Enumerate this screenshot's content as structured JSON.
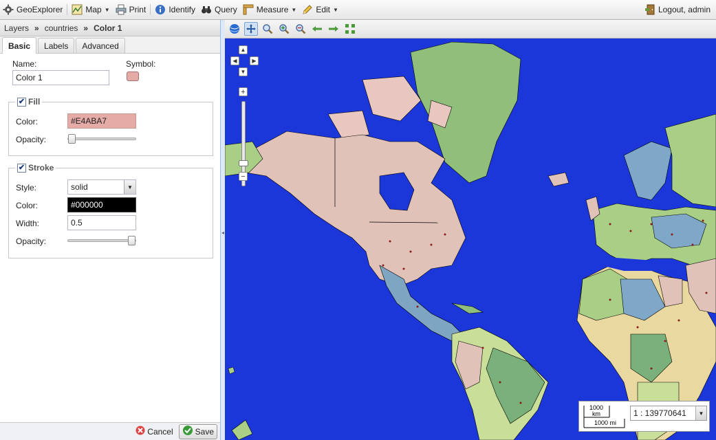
{
  "toolbar": {
    "app_name": "GeoExplorer",
    "map": "Map",
    "print": "Print",
    "identify": "Identify",
    "query": "Query",
    "measure": "Measure",
    "edit": "Edit",
    "logout": "Logout, admin"
  },
  "breadcrumb": {
    "root": "Layers",
    "sep": "»",
    "layer": "countries",
    "rule": "Color 1"
  },
  "tabs": [
    "Basic",
    "Labels",
    "Advanced"
  ],
  "form": {
    "name_label": "Name:",
    "name_value": "Color 1",
    "symbol_label": "Symbol:",
    "symbol_color": "#E4ABA7",
    "fill": {
      "legend": "Fill",
      "checked": true,
      "color_label": "Color:",
      "color_value": "#E4ABA7",
      "opacity_label": "Opacity:",
      "opacity": 0.0
    },
    "stroke": {
      "legend": "Stroke",
      "checked": true,
      "style_label": "Style:",
      "style_value": "solid",
      "color_label": "Color:",
      "color_value": "#000000",
      "width_label": "Width:",
      "width_value": "0.5",
      "opacity_label": "Opacity:",
      "opacity": 1.0
    }
  },
  "footer": {
    "cancel": "Cancel",
    "save": "Save"
  },
  "map": {
    "ocean_color": "#1B36D9",
    "scale_value": "1 : 139770641",
    "scalebar_km": "1000 km",
    "scalebar_km_top": "1000",
    "scalebar_km_unit": "km",
    "scalebar_mi": "1000 mi"
  }
}
